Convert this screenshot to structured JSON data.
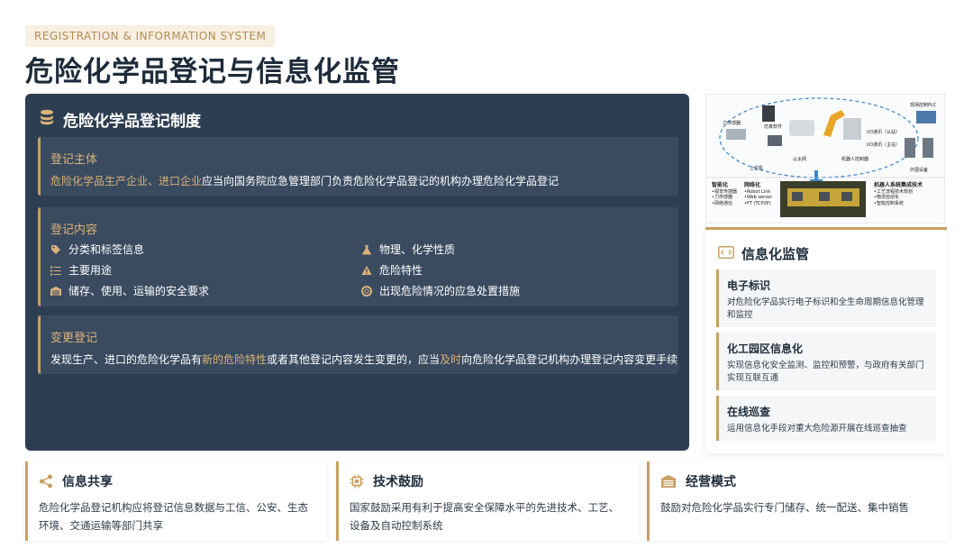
{
  "header": {
    "tag": "REGISTRATION & INFORMATION SYSTEM",
    "title": "危险化学品登记与信息化监管"
  },
  "registration": {
    "title": "危险化学品登记制度",
    "subject": {
      "title": "登记主体",
      "highlight": "危险化学品生产企业、进口企业",
      "text": "应当向国务院应急管理部门负责危险化学品登记的机构办理危险化学品登记"
    },
    "content": {
      "title": "登记内容",
      "items": [
        {
          "label": "分类和标签信息",
          "icon": "tag-icon"
        },
        {
          "label": "物理、化学性质",
          "icon": "flask-icon"
        },
        {
          "label": "主要用途",
          "icon": "list-icon"
        },
        {
          "label": "危险特性",
          "icon": "warning-icon"
        },
        {
          "label": "储存、使用、运输的安全要求",
          "icon": "warehouse-icon"
        },
        {
          "label": "出现危险情况的应急处置措施",
          "icon": "lifebuoy-icon"
        }
      ]
    },
    "change": {
      "title": "变更登记",
      "text1": "发现生产、进口的危险化学品有",
      "highlight1": "新的危险特性",
      "text2": "或者其他登记内容发生变更的，应当",
      "highlight2": "及时",
      "text3": "向危险化学品登记机构办理登记内容变更手续"
    }
  },
  "photo": {
    "labels": [
      "力传感器",
      "仿真软件",
      "上位机",
      "以太网",
      "机器人控制器",
      "I/O通讯（从站）",
      "I/O通讯（主站）",
      "现场控制PLC",
      "外围设备"
    ],
    "bottom": [
      {
        "title": "智能化",
        "lines": [
          "•视觉传感器",
          "•力传感器",
          "•网络通信"
        ]
      },
      {
        "title": "网络化",
        "lines": [
          "•Robot Link",
          "•Web server",
          "•FT (TCP/IP)"
        ]
      },
      {
        "title": "机器人系统集成技术",
        "lines": [
          "•工艺流程技术规划",
          "•物流自动化",
          "•智能控制系统"
        ]
      }
    ]
  },
  "monitoring": {
    "title": "信息化监管",
    "cards": [
      {
        "title": "电子标识",
        "text": "对危险化学品实行电子标识和全生命周期信息化管理和监控"
      },
      {
        "title": "化工园区信息化",
        "text": "实现信息化安全监测、监控和预警，与政府有关部门实现互联互通"
      },
      {
        "title": "在线巡查",
        "text": "运用信息化手段对重大危险源开展在线巡查抽查"
      }
    ]
  },
  "bottom_cards": [
    {
      "title": "信息共享",
      "icon": "share-icon",
      "text": "危险化学品登记机构应将登记信息数据与工信、公安、生态环境、交通运输等部门共享"
    },
    {
      "title": "技术鼓励",
      "icon": "chip-icon",
      "text": "国家鼓励采用有利于提高安全保障水平的先进技术、工艺、设备及自动控制系统"
    },
    {
      "title": "经营模式",
      "icon": "store-icon",
      "text": "鼓励对危险化学品实行专门储存、统一配送、集中销售"
    }
  ],
  "colors": {
    "accent": "#c8a063",
    "dark_panel": "#2e3e52",
    "card": "#3a4b60"
  }
}
